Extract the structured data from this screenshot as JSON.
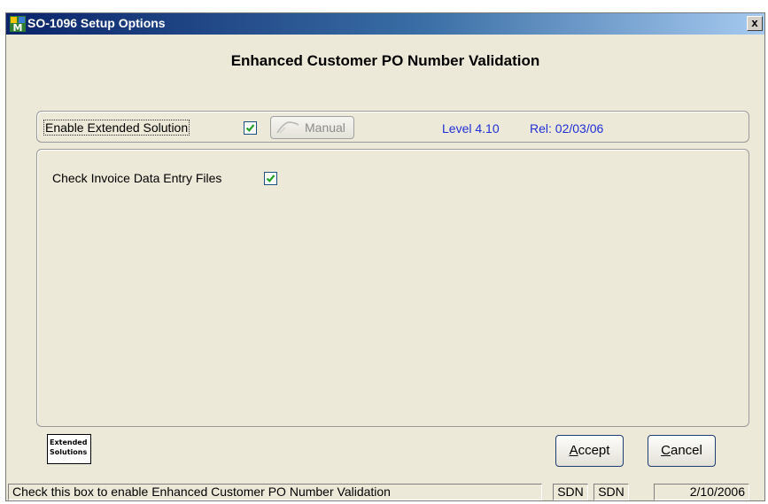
{
  "window": {
    "title": "SO-1096 Setup Options",
    "close_symbol": "x",
    "app_icon": "app-m-icon"
  },
  "heading": "Enhanced Customer PO Number Validation",
  "top_panel": {
    "enable_label": "Enable Extended Solution",
    "enable_checked": true,
    "manual_button": "Manual",
    "manual_icon": "manual-book-icon",
    "level": "Level 4.10",
    "release": "Rel: 02/03/06",
    "info_color": "#1f2fd6"
  },
  "main_panel": {
    "check_invoice_label": "Check Invoice Data Entry Files",
    "check_invoice_checked": true
  },
  "logo": {
    "line1": "Extended",
    "line2": "Solutions"
  },
  "buttons": {
    "accept_prefix": "A",
    "accept_rest": "ccept",
    "cancel_prefix": "C",
    "cancel_rest": "ancel"
  },
  "statusbar": {
    "message": "Check this box to enable Enhanced Customer PO Number Validation",
    "field1": "SDN",
    "field2": "SDN",
    "date": "2/10/2006"
  },
  "colors": {
    "title_gradient_start": "#0a246a",
    "window_bg": "#ece9d8",
    "checkmark": "#21a121"
  }
}
